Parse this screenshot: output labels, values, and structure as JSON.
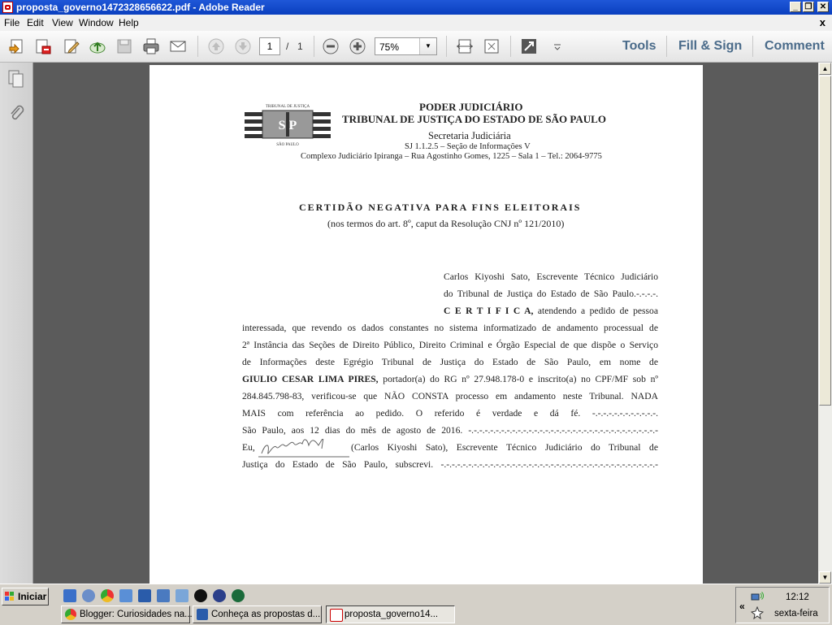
{
  "window": {
    "title": "proposta_governo1472328656622.pdf - Adobe Reader",
    "min": "_",
    "restore": "❐",
    "close": "✕"
  },
  "menu": {
    "items": [
      "File",
      "Edit",
      "View",
      "Window",
      "Help"
    ],
    "close": "x"
  },
  "toolbar": {
    "page_current": "1",
    "page_sep": "/",
    "page_total": "1",
    "zoom": "75%",
    "tools": "Tools",
    "fill_sign": "Fill & Sign",
    "comment": "Comment",
    "icons": [
      "open-icon",
      "create-pdf-icon",
      "edit-icon",
      "upload-icon",
      "save-icon",
      "print-icon",
      "email-icon",
      "prev-page-icon",
      "next-page-icon",
      "zoom-out-icon",
      "zoom-in-icon",
      "fit-width-icon",
      "fit-page-icon",
      "fullscreen-icon",
      "customize-icon"
    ]
  },
  "document": {
    "logo_top": "TRIBUNAL DE JUSTIÇA",
    "logo_bottom": "SÃO PAULO",
    "logo_letters": "S P",
    "h1": "PODER JUDICIÁRIO",
    "h2": "TRIBUNAL DE JUSTIÇA DO ESTADO DE SÃO PAULO",
    "h3": "Secretaria Judiciária",
    "h4": "SJ 1.1.2.5 – Seção de Informações V",
    "h5": "Complexo Judiciário Ipiranga – Rua Agostinho Gomes, 1225 – Sala 1 – Tel.: 2064-9775",
    "cert_title": "CERTIDÃO NEGATIVA PARA FINS ELEITORAIS",
    "cert_sub": "(nos termos do art. 8º, caput da Resolução CNJ nº 121/2010)",
    "l1": "Carlos Kiyoshi Sato, Escrevente Técnico Judiciário",
    "l2": "do Tribunal de Justiça do Estado de São Paulo.-.-.-.-.",
    "l3a": "C E R T I F I C A,",
    "l3b": " atendendo a pedido de pessoa",
    "l4": "interessada, que revendo os dados constantes no sistema informatizado de andamento processual de",
    "l5": "2ª Instância das Seções de Direito Público, Direito Criminal e Órgão Especial de que dispõe o Serviço",
    "l6": "de Informações deste Egrégio Tribunal de Justiça do Estado de São Paulo, em nome de",
    "l7a": "GIULIO CESAR LIMA PIRES,",
    "l7b": " portador(a) do RG nº 27.948.178-0 e inscrito(a) no CPF/MF sob nº",
    "l8": "284.845.798-83, verificou-se que NÃO CONSTA processo em andamento neste Tribunal. NADA",
    "l9": "MAIS com referência ao pedido. O referido é verdade e dá fé. -.-.-.-.-.-.-.-.-.-.-.-.",
    "l10": "São Paulo, aos 12 dias do mês de agosto de 2016. -.-.-.-.-.-.-.-.-.-.-.-.-.-.-.-.-.-.-.-.-.-.-.-.-.-.-.-.-.-.-.-.-.-.-",
    "l11a": "Eu,",
    "l11b": "(Carlos Kiyoshi Sato), Escrevente Técnico Judiciário do Tribunal de",
    "l12": "Justiça do Estado de São Paulo, subscrevi. -.-.-.-.-.-.-.-.-.-.-.-.-.-.-.-.-.-.-.-.-.-.-.-.-.-.-.-.-.-.-.-.-.-.-.-.-.-.-.-"
  },
  "taskbar": {
    "start": "Iniciar",
    "tasks": [
      "Blogger: Curiosidades na...",
      "Conheça as propostas d...",
      "proposta_governo14..."
    ],
    "time": "12:12",
    "day": "sexta-feira",
    "chevron": "«"
  },
  "colors": {
    "titlebar": "#0a3fbf",
    "doc_bg": "#5b5b5b",
    "link": "#4a6b8a"
  }
}
